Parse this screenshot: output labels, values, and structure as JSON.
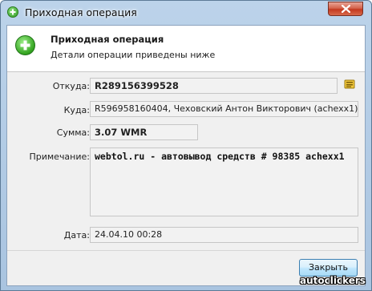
{
  "window": {
    "title": "Приходная операция"
  },
  "header": {
    "title": "Приходная операция",
    "subtitle": "Детали операции приведены ниже"
  },
  "fields": {
    "from": {
      "label": "Откуда:",
      "value": "R289156399528"
    },
    "to": {
      "label": "Куда:",
      "value": "R596958160404, Чеховский Антон Викторович (achexx1)"
    },
    "amount": {
      "label": "Сумма:",
      "value": "3.07 WMR"
    },
    "note": {
      "label": "Примечание:",
      "value": "webtol.ru - автовывод средств # 98385 achexx1"
    },
    "date": {
      "label": "Дата:",
      "value": "24.04.10 00:28"
    }
  },
  "buttons": {
    "close_label": "Закрыть"
  },
  "watermark": "autoclickers",
  "icons": {
    "title": "plus-icon",
    "header": "plus-icon",
    "copy": "copy-icon",
    "close": "close-icon"
  },
  "colors": {
    "accent_green": "#33a31f",
    "window_frame": "#a9c4e0",
    "close_button": "#c3381f"
  }
}
